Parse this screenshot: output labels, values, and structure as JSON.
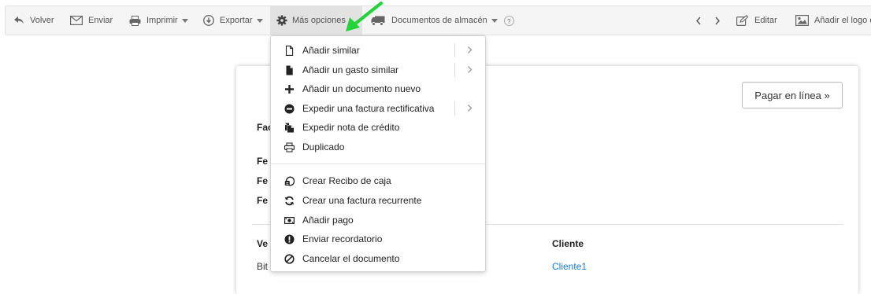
{
  "toolbar": {
    "volver": "Volver",
    "enviar": "Enviar",
    "imprimir": "Imprimir",
    "exportar": "Exportar",
    "mas_opciones": "Más opciones",
    "documentos": "Documentos de almacén",
    "help": "?",
    "editar": "Editar",
    "anadir_logo": "Añadir el logo d"
  },
  "menu": {
    "items": [
      {
        "label": "Añadir similar",
        "icon": "document-outline-icon",
        "submenu": true
      },
      {
        "label": "Añadir un gasto similar",
        "icon": "document-filled-icon",
        "submenu": true
      },
      {
        "label": "Añadir un documento nuevo",
        "icon": "plus-icon",
        "submenu": false
      },
      {
        "label": "Expedir una factura rectificativa",
        "icon": "minus-circle-icon",
        "submenu": true
      },
      {
        "label": "Expedir nota de crédito",
        "icon": "copy-documents-icon",
        "submenu": false
      },
      {
        "label": "Duplicado",
        "icon": "duplicate-printer-icon",
        "submenu": false
      },
      {
        "label": "Crear Recibo de caja",
        "icon": "cash-register-icon",
        "submenu": false
      },
      {
        "label": "Crear una factura recurrente",
        "icon": "refresh-icon",
        "submenu": false
      },
      {
        "label": "Añadir pago",
        "icon": "money-icon",
        "submenu": false
      },
      {
        "label": "Enviar recordatorio",
        "icon": "exclamation-circle-icon",
        "submenu": false
      },
      {
        "label": "Cancelar el documento",
        "icon": "ban-icon",
        "submenu": false
      }
    ]
  },
  "document": {
    "pay_button": "Pagar en línea »",
    "labels": [
      "Fac",
      "Fe",
      "Fe",
      "Fe"
    ],
    "vendor_head": "Ve",
    "client_head": "Cliente",
    "vendor_value": "Bit",
    "client_value": "Cliente1"
  },
  "colors": {
    "link": "#1a7ac7",
    "annotation_arrow": "#22d33a",
    "toolbar_bg": "#f5f5f5"
  }
}
